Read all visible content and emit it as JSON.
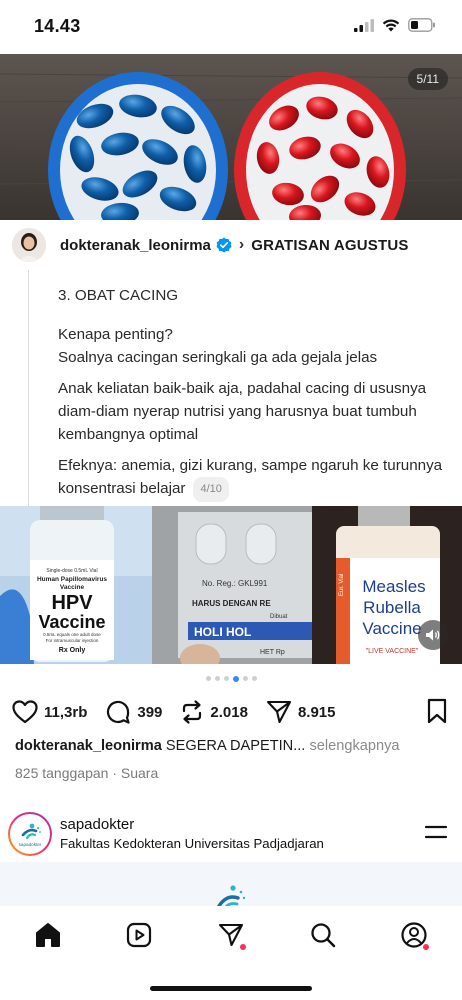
{
  "status_bar": {
    "time": "14.43"
  },
  "hero": {
    "page_indicator": "5/11"
  },
  "quoted_post": {
    "username": "dokteranak_leonirma",
    "tag": "GRATISAN AGUSTUS",
    "heading": "3. OBAT CACING",
    "paragraphs": [
      "Kenapa penting?\nSoalnya cacingan seringkali ga ada gejala jelas",
      "Anak keliatan baik-baik aja, padahal cacing di ususnya diam-diam nyerap nutrisi yang harusnya buat tumbuh kembangnya optimal",
      "Efeknya: anemia, gizi kurang, sampe ngaruh ke turunnya konsentrasi belajar"
    ],
    "counter": "4/10"
  },
  "images": {
    "hpv_vial": {
      "line1": "Single-dose 0.5mL Vial",
      "line2": "Human Papillomavirus",
      "line3": "Vaccine",
      "title1": "HPV",
      "title2": "Vaccine",
      "small1": "0.5mL equals one adult dose",
      "small2": "For intramuscular injection",
      "rx": "Rx Only"
    },
    "blister": {
      "reg": "No. Reg.: GKL991",
      "warn": "HARUS DENGAN RE",
      "dibuat": "Dibuat",
      "brand": "HOLI  HOL",
      "het": "HET Rp"
    },
    "mr_vial": {
      "side": "Eur. Vial",
      "title1": "Measles",
      "title2": "Rubella",
      "title3": "Vaccine",
      "live": "\"LIVE VACCINE\""
    }
  },
  "carousel": {
    "dot_count": 6,
    "active_index": 3
  },
  "actions": {
    "likes": "11,3rb",
    "comments": "399",
    "reposts": "2.018",
    "shares": "8.915"
  },
  "caption": {
    "username": "dokteranak_leonirma",
    "text": "SEGERA DAPETIN...",
    "more": "selengkapnya"
  },
  "meta": {
    "text": "825 tanggapan · Suara"
  },
  "next_post": {
    "username": "sapadokter",
    "subtitle": "Fakultas Kedokteran Universitas Padjadjaran",
    "avatar_text": "sapadokter"
  },
  "colors": {
    "accent_blue": "#3a85ff",
    "notification_red": "#ff2d55",
    "verified_blue": "#0095f6"
  }
}
